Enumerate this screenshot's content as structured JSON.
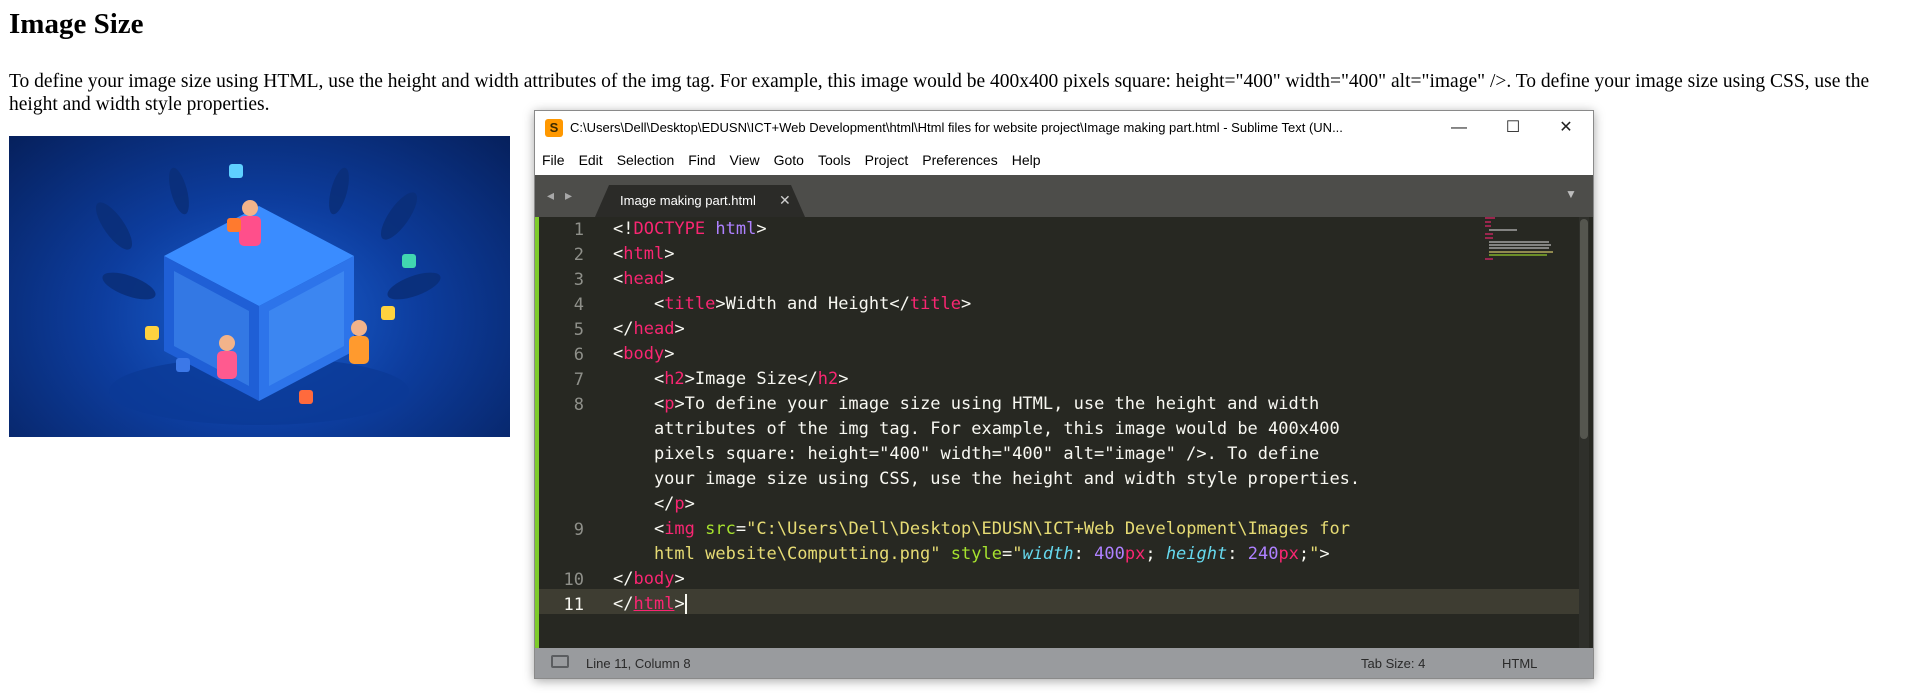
{
  "page": {
    "heading": "Image Size",
    "paragraph": "To define your image size using HTML, use the height and width attributes of the img tag. For example, this image would be 400x400 pixels square: height=\"400\" width=\"400\" alt=\"image\" />. To define your image size using CSS, use the height and width style properties."
  },
  "window": {
    "title": "C:\\Users\\Dell\\Desktop\\EDUSN\\ICT+Web Development\\html\\Html files for website project\\Image making part.html - Sublime Text (UN...",
    "minimize": "—",
    "maximize": "☐",
    "close": "✕",
    "icon": "sublime-logo-icon"
  },
  "menu": [
    "File",
    "Edit",
    "Selection",
    "Find",
    "View",
    "Goto",
    "Tools",
    "Project",
    "Preferences",
    "Help"
  ],
  "tab": {
    "label": "Image making part.html",
    "close": "✕"
  },
  "tabbar": {
    "nav_left": "◂",
    "nav_right": "▸",
    "dropdown": "▼"
  },
  "editor": {
    "line_numbers": [
      "1",
      "2",
      "3",
      "4",
      "5",
      "6",
      "7",
      "8",
      "9",
      "10",
      "11"
    ]
  },
  "status": {
    "position": "Line 11, Column 8",
    "tab_size": "Tab Size: 4",
    "syntax": "HTML"
  },
  "colors": {
    "accent": "#7ecb2b",
    "tag": "#f92672",
    "attr": "#a6e22e",
    "string": "#e6db74",
    "number": "#ae81ff"
  }
}
